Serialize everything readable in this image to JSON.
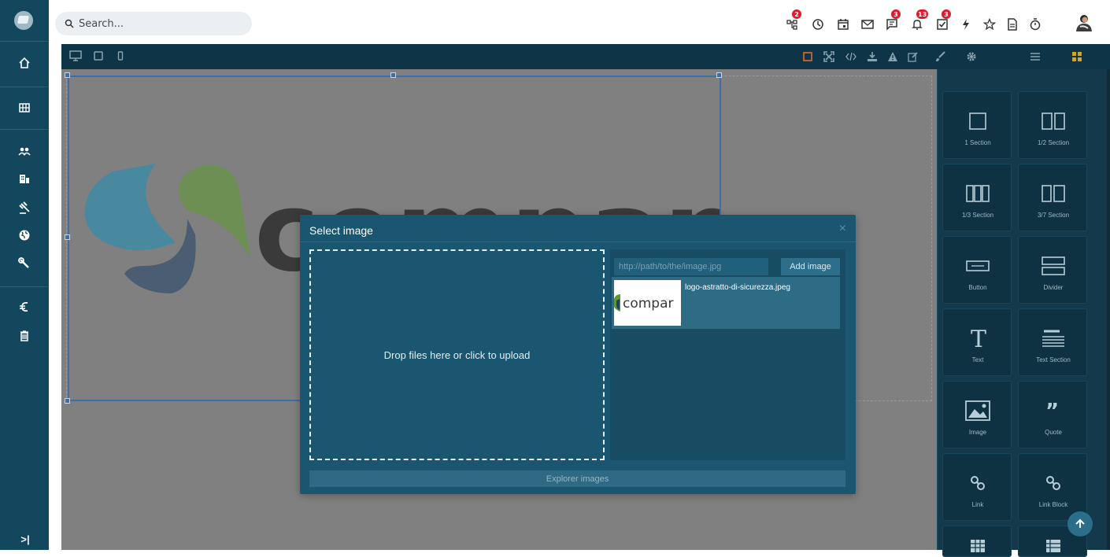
{
  "search": {
    "placeholder": "Search..."
  },
  "topbar": {
    "icons": [
      {
        "name": "network-icon",
        "badge": "2"
      },
      {
        "name": "history-icon",
        "badge": ""
      },
      {
        "name": "calendar-icon",
        "badge": ""
      },
      {
        "name": "mail-icon",
        "badge": ""
      },
      {
        "name": "chat-icon",
        "badge": "3"
      },
      {
        "name": "bell-icon",
        "badge": "13"
      },
      {
        "name": "tasks-icon",
        "badge": "3"
      },
      {
        "name": "flash-icon",
        "badge": ""
      },
      {
        "name": "star-icon",
        "badge": ""
      },
      {
        "name": "document-icon",
        "badge": ""
      },
      {
        "name": "stopwatch-icon",
        "badge": ""
      }
    ]
  },
  "sidebar": {
    "items": [
      "home-icon",
      "grid-icon",
      "users-icon",
      "building-icon",
      "gavel-icon",
      "globe-icon",
      "wrench-icon",
      "euro-icon",
      "trash-icon"
    ],
    "collapse_label": ">|"
  },
  "editor": {
    "devices": [
      "desktop-icon",
      "tablet-icon",
      "mobile-icon"
    ],
    "tools": [
      "select-outline-icon",
      "fullscreen-icon",
      "code-icon",
      "import-icon",
      "warning-icon",
      "edit-icon",
      "brush-icon",
      "settings-icon",
      "layers-icon",
      "blocks-icon"
    ]
  },
  "canvas": {
    "logo_text": "company"
  },
  "blocks": [
    {
      "label": "1 Section"
    },
    {
      "label": "1/2 Section"
    },
    {
      "label": "1/3 Section"
    },
    {
      "label": "3/7 Section"
    },
    {
      "label": "Button"
    },
    {
      "label": "Divider"
    },
    {
      "label": "Text"
    },
    {
      "label": "Text Section"
    },
    {
      "label": "Image"
    },
    {
      "label": "Quote"
    },
    {
      "label": "Link"
    },
    {
      "label": "Link Block"
    }
  ],
  "modal": {
    "title": "Select image",
    "close": "×",
    "dropzone_text": "Drop files here or click to upload",
    "url_placeholder": "http://path/to/the/image.jpg",
    "add_button": "Add image",
    "asset_name": "logo-astratto-di-sicurezza.jpeg",
    "asset_thumb_text": "compar",
    "explorer_button": "Explorer images"
  },
  "colors": {
    "sidebar": "#13475d",
    "modal": "#1a5670",
    "badge": "#e01b2a",
    "logo_blue": "#1a8fb8",
    "logo_green": "#5c9a2d",
    "logo_navy": "#1f3f68"
  }
}
